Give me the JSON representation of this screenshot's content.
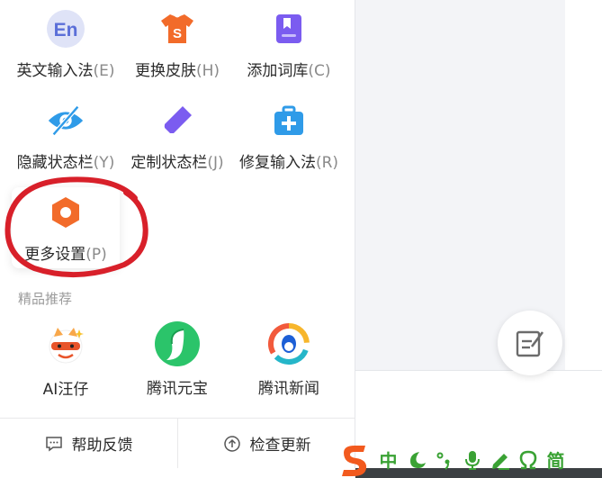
{
  "menu": {
    "items": [
      {
        "label": "英文输入法",
        "key": "(E)",
        "icon": "english-en-icon"
      },
      {
        "label": "更换皮肤",
        "key": "(H)",
        "icon": "tshirt-skin-icon"
      },
      {
        "label": "添加词库",
        "key": "(C)",
        "icon": "bookmark-dictionary-icon"
      },
      {
        "label": "隐藏状态栏",
        "key": "(Y)",
        "icon": "eye-hidden-icon"
      },
      {
        "label": "定制状态栏",
        "key": "(J)",
        "icon": "pencil-ruler-icon"
      },
      {
        "label": "修复输入法",
        "key": "(R)",
        "icon": "toolbox-repair-icon"
      },
      {
        "label": "更多设置",
        "key": "(P)",
        "icon": "hexagon-settings-icon"
      }
    ],
    "section_title": "精品推荐",
    "recommendations": [
      {
        "label": "AI汪仔",
        "icon": "ai-wangzai-mascot-icon"
      },
      {
        "label": "腾讯元宝",
        "icon": "tencent-yuanbao-icon"
      },
      {
        "label": "腾讯新闻",
        "icon": "tencent-news-icon"
      }
    ],
    "footer": {
      "help_label": "帮助反馈",
      "update_label": "检查更新"
    }
  },
  "ime_toolbar": {
    "mode_label": "中",
    "script_label": "简",
    "accent_color": "#3aa234"
  },
  "colors": {
    "annotation": "#d8202a",
    "brand_orange": "#f26b2a"
  }
}
